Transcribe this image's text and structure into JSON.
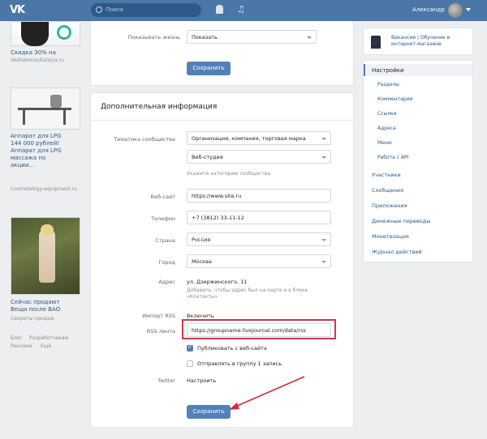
{
  "topbar": {
    "logo": "VK",
    "search_placeholder": "Поиск",
    "user_name": "Александр"
  },
  "left_ads": {
    "ad1_title": "Скидка 30% на",
    "ad1_sub": "Vashakonsultatsiya.ru",
    "ad2_title": "Аппарат для LPG",
    "ad2_lines": [
      "144 000 рублей!",
      "Аппарат для LPG",
      "массажа по",
      "акции..."
    ],
    "ad2_sub": "Cosmetology-equipment.ru",
    "ad3_title": "Сейчас продают",
    "ad3_lines": [
      "Вещи после ВАО"
    ],
    "ad3_sub": "Секреты продаж",
    "footer_links": [
      "Блог",
      "Разработчикам",
      "Реклама",
      "Ещё"
    ]
  },
  "top_card": {
    "label": "Показывать жизнь",
    "value": "Показать",
    "save_button": "Сохранить"
  },
  "main_card": {
    "title": "Дополнительная информация",
    "rows": [
      {
        "label": "Тематика сообщества",
        "value": "Организация, компания, торговая марка"
      },
      {
        "label": "",
        "value": "Веб-студия"
      },
      {
        "label": "Веб-сайт",
        "value": "https://www.site.ru"
      },
      {
        "label": "Телефон",
        "value": "+7 (3812) 33-11-12"
      },
      {
        "label": "Страна",
        "value": "Россия"
      },
      {
        "label": "Город",
        "value": "Москва"
      }
    ],
    "category_hint": "Укажите категорию сообщества",
    "address_label": "Адрес",
    "address_value": "ул. Дзержинского, 11",
    "address_hint": "Добавить, чтобы адрес был на карте и в блоке «Контакты»",
    "import_label": "Импорт RSS",
    "import_value": "Включить",
    "rss_label": "RSS-лента",
    "rss_value": "https://groupname.livejournal.com/data/rss",
    "checkbox1_label": "Публиковать с веб-сайта",
    "checkbox2_label": "Отправлять в группу 1 запись",
    "twitter_label": "Twitter",
    "twitter_value": "Настроить",
    "save_button": "Сохранить"
  },
  "right_panel": {
    "app_title_line1": "Вакансии | Обучение в",
    "app_title_line2": "интернет-магазине",
    "active_item": "Настройки",
    "sub_items": [
      "Разделы",
      "Комментарии",
      "Ссылки",
      "Адреса",
      "Меню",
      "Работа с API"
    ],
    "items": [
      "Участники",
      "Сообщения",
      "Приложения",
      "Денежные переводы",
      "Монетизация",
      "Журнал действий"
    ]
  },
  "colors": {
    "brand": "#4a76a8",
    "button": "#5181b8",
    "highlight": "#c9394d",
    "background": "#edeef0"
  }
}
